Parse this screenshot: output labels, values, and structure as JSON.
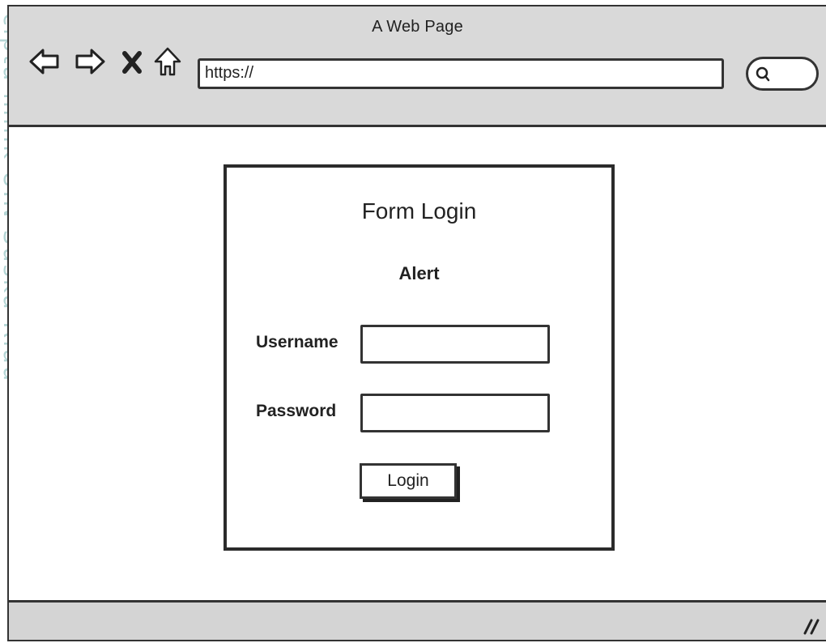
{
  "window": {
    "title": "A Web Page"
  },
  "toolbar": {
    "back_icon": "back-arrow-icon",
    "forward_icon": "forward-arrow-icon",
    "stop_icon": "close-icon",
    "home_icon": "home-icon",
    "address_value": "https://"
  },
  "search": {
    "icon": "search-icon"
  },
  "form": {
    "title": "Form Login",
    "alert": "Alert",
    "username_label": "Username",
    "username_value": "",
    "password_label": "Password",
    "password_value": "",
    "login_label": "Login"
  },
  "watermark": {
    "side_text": "cipta milik UIN Suska Riau"
  },
  "colors": {
    "chrome": "#d9d9d9",
    "border": "#333333",
    "watermark": "#b5d6d6"
  }
}
